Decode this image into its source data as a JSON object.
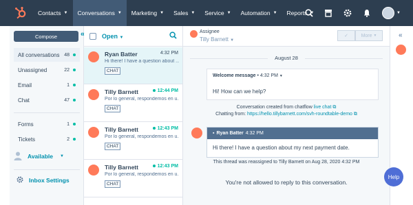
{
  "nav": {
    "items": [
      "Contacts",
      "Conversations",
      "Marketing",
      "Sales",
      "Service",
      "Automation",
      "Reports"
    ],
    "active_index": 1
  },
  "sidebar": {
    "compose_label": "Compose",
    "items": [
      {
        "label": "All conversations",
        "count": "48"
      },
      {
        "label": "Unassigned",
        "count": "22"
      },
      {
        "label": "Email",
        "count": "1"
      },
      {
        "label": "Chat",
        "count": "47"
      },
      {
        "label": "Forms",
        "count": "1"
      },
      {
        "label": "Tickets",
        "count": "2"
      }
    ],
    "availability": "Available",
    "inbox_settings": "Inbox Settings"
  },
  "list": {
    "filter": "Open",
    "items": [
      {
        "name": "Ryan Batter",
        "time": "4:32 PM",
        "preview": "Hi there! I have a question about ...",
        "tag": "CHAT"
      },
      {
        "name": "Tilly Barnett",
        "time": "12:44 PM",
        "preview": "Por lo general, respondemos en u...",
        "tag": "CHAT"
      },
      {
        "name": "Tilly Barnett",
        "time": "12:43 PM",
        "preview": "Por lo general, respondemos en u...",
        "tag": "CHAT"
      },
      {
        "name": "Tilly Barnett",
        "time": "12:43 PM",
        "preview": "Por lo general, respondemos en u...",
        "tag": "CHAT"
      }
    ]
  },
  "thread": {
    "assignee_label": "Assignee",
    "assignee_name": "Tilly Barnett",
    "more_label": "More",
    "date": "August 28",
    "welcome_title": "Welcome message",
    "welcome_time": "4:32 PM",
    "welcome_text": "Hi! How can we help?",
    "created_text": "Conversation created from chatflow",
    "created_link": "live chat",
    "chatting_label": "Chatting from:",
    "chatting_url": "https://hello.tillybarnett.com/svh-roundtable-demo",
    "msg_name": "Ryan Batter",
    "msg_time": "4:32 PM",
    "msg_text": "Hi there! I have a question about my next payment date.",
    "reassigned": "This thread was reassigned to Tilly Barnett on Aug 28, 2020 4:32 PM",
    "not_allowed": "You're not allowed to reply to this conversation."
  },
  "help_label": "Help",
  "colors": {
    "nav_bg": "#2d3e50",
    "accent": "#0091ae",
    "orange": "#ff7a59",
    "teal": "#00bda5"
  }
}
